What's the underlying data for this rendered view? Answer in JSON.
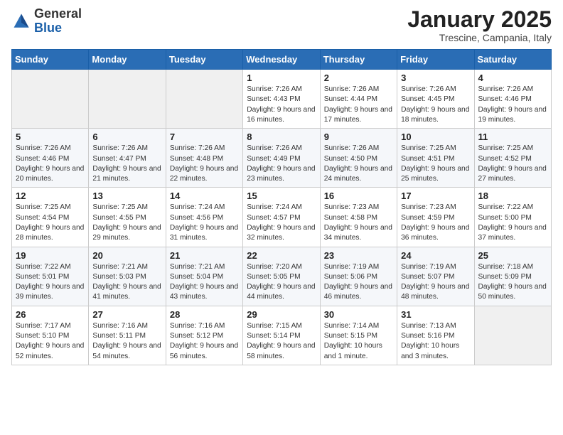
{
  "header": {
    "logo_general": "General",
    "logo_blue": "Blue",
    "month_title": "January 2025",
    "location": "Trescine, Campania, Italy"
  },
  "days_of_week": [
    "Sunday",
    "Monday",
    "Tuesday",
    "Wednesday",
    "Thursday",
    "Friday",
    "Saturday"
  ],
  "weeks": [
    [
      {
        "num": "",
        "sunrise": "",
        "sunset": "",
        "daylight": ""
      },
      {
        "num": "",
        "sunrise": "",
        "sunset": "",
        "daylight": ""
      },
      {
        "num": "",
        "sunrise": "",
        "sunset": "",
        "daylight": ""
      },
      {
        "num": "1",
        "sunrise": "Sunrise: 7:26 AM",
        "sunset": "Sunset: 4:43 PM",
        "daylight": "Daylight: 9 hours and 16 minutes."
      },
      {
        "num": "2",
        "sunrise": "Sunrise: 7:26 AM",
        "sunset": "Sunset: 4:44 PM",
        "daylight": "Daylight: 9 hours and 17 minutes."
      },
      {
        "num": "3",
        "sunrise": "Sunrise: 7:26 AM",
        "sunset": "Sunset: 4:45 PM",
        "daylight": "Daylight: 9 hours and 18 minutes."
      },
      {
        "num": "4",
        "sunrise": "Sunrise: 7:26 AM",
        "sunset": "Sunset: 4:46 PM",
        "daylight": "Daylight: 9 hours and 19 minutes."
      }
    ],
    [
      {
        "num": "5",
        "sunrise": "Sunrise: 7:26 AM",
        "sunset": "Sunset: 4:46 PM",
        "daylight": "Daylight: 9 hours and 20 minutes."
      },
      {
        "num": "6",
        "sunrise": "Sunrise: 7:26 AM",
        "sunset": "Sunset: 4:47 PM",
        "daylight": "Daylight: 9 hours and 21 minutes."
      },
      {
        "num": "7",
        "sunrise": "Sunrise: 7:26 AM",
        "sunset": "Sunset: 4:48 PM",
        "daylight": "Daylight: 9 hours and 22 minutes."
      },
      {
        "num": "8",
        "sunrise": "Sunrise: 7:26 AM",
        "sunset": "Sunset: 4:49 PM",
        "daylight": "Daylight: 9 hours and 23 minutes."
      },
      {
        "num": "9",
        "sunrise": "Sunrise: 7:26 AM",
        "sunset": "Sunset: 4:50 PM",
        "daylight": "Daylight: 9 hours and 24 minutes."
      },
      {
        "num": "10",
        "sunrise": "Sunrise: 7:25 AM",
        "sunset": "Sunset: 4:51 PM",
        "daylight": "Daylight: 9 hours and 25 minutes."
      },
      {
        "num": "11",
        "sunrise": "Sunrise: 7:25 AM",
        "sunset": "Sunset: 4:52 PM",
        "daylight": "Daylight: 9 hours and 27 minutes."
      }
    ],
    [
      {
        "num": "12",
        "sunrise": "Sunrise: 7:25 AM",
        "sunset": "Sunset: 4:54 PM",
        "daylight": "Daylight: 9 hours and 28 minutes."
      },
      {
        "num": "13",
        "sunrise": "Sunrise: 7:25 AM",
        "sunset": "Sunset: 4:55 PM",
        "daylight": "Daylight: 9 hours and 29 minutes."
      },
      {
        "num": "14",
        "sunrise": "Sunrise: 7:24 AM",
        "sunset": "Sunset: 4:56 PM",
        "daylight": "Daylight: 9 hours and 31 minutes."
      },
      {
        "num": "15",
        "sunrise": "Sunrise: 7:24 AM",
        "sunset": "Sunset: 4:57 PM",
        "daylight": "Daylight: 9 hours and 32 minutes."
      },
      {
        "num": "16",
        "sunrise": "Sunrise: 7:23 AM",
        "sunset": "Sunset: 4:58 PM",
        "daylight": "Daylight: 9 hours and 34 minutes."
      },
      {
        "num": "17",
        "sunrise": "Sunrise: 7:23 AM",
        "sunset": "Sunset: 4:59 PM",
        "daylight": "Daylight: 9 hours and 36 minutes."
      },
      {
        "num": "18",
        "sunrise": "Sunrise: 7:22 AM",
        "sunset": "Sunset: 5:00 PM",
        "daylight": "Daylight: 9 hours and 37 minutes."
      }
    ],
    [
      {
        "num": "19",
        "sunrise": "Sunrise: 7:22 AM",
        "sunset": "Sunset: 5:01 PM",
        "daylight": "Daylight: 9 hours and 39 minutes."
      },
      {
        "num": "20",
        "sunrise": "Sunrise: 7:21 AM",
        "sunset": "Sunset: 5:03 PM",
        "daylight": "Daylight: 9 hours and 41 minutes."
      },
      {
        "num": "21",
        "sunrise": "Sunrise: 7:21 AM",
        "sunset": "Sunset: 5:04 PM",
        "daylight": "Daylight: 9 hours and 43 minutes."
      },
      {
        "num": "22",
        "sunrise": "Sunrise: 7:20 AM",
        "sunset": "Sunset: 5:05 PM",
        "daylight": "Daylight: 9 hours and 44 minutes."
      },
      {
        "num": "23",
        "sunrise": "Sunrise: 7:19 AM",
        "sunset": "Sunset: 5:06 PM",
        "daylight": "Daylight: 9 hours and 46 minutes."
      },
      {
        "num": "24",
        "sunrise": "Sunrise: 7:19 AM",
        "sunset": "Sunset: 5:07 PM",
        "daylight": "Daylight: 9 hours and 48 minutes."
      },
      {
        "num": "25",
        "sunrise": "Sunrise: 7:18 AM",
        "sunset": "Sunset: 5:09 PM",
        "daylight": "Daylight: 9 hours and 50 minutes."
      }
    ],
    [
      {
        "num": "26",
        "sunrise": "Sunrise: 7:17 AM",
        "sunset": "Sunset: 5:10 PM",
        "daylight": "Daylight: 9 hours and 52 minutes."
      },
      {
        "num": "27",
        "sunrise": "Sunrise: 7:16 AM",
        "sunset": "Sunset: 5:11 PM",
        "daylight": "Daylight: 9 hours and 54 minutes."
      },
      {
        "num": "28",
        "sunrise": "Sunrise: 7:16 AM",
        "sunset": "Sunset: 5:12 PM",
        "daylight": "Daylight: 9 hours and 56 minutes."
      },
      {
        "num": "29",
        "sunrise": "Sunrise: 7:15 AM",
        "sunset": "Sunset: 5:14 PM",
        "daylight": "Daylight: 9 hours and 58 minutes."
      },
      {
        "num": "30",
        "sunrise": "Sunrise: 7:14 AM",
        "sunset": "Sunset: 5:15 PM",
        "daylight": "Daylight: 10 hours and 1 minute."
      },
      {
        "num": "31",
        "sunrise": "Sunrise: 7:13 AM",
        "sunset": "Sunset: 5:16 PM",
        "daylight": "Daylight: 10 hours and 3 minutes."
      },
      {
        "num": "",
        "sunrise": "",
        "sunset": "",
        "daylight": ""
      }
    ]
  ]
}
